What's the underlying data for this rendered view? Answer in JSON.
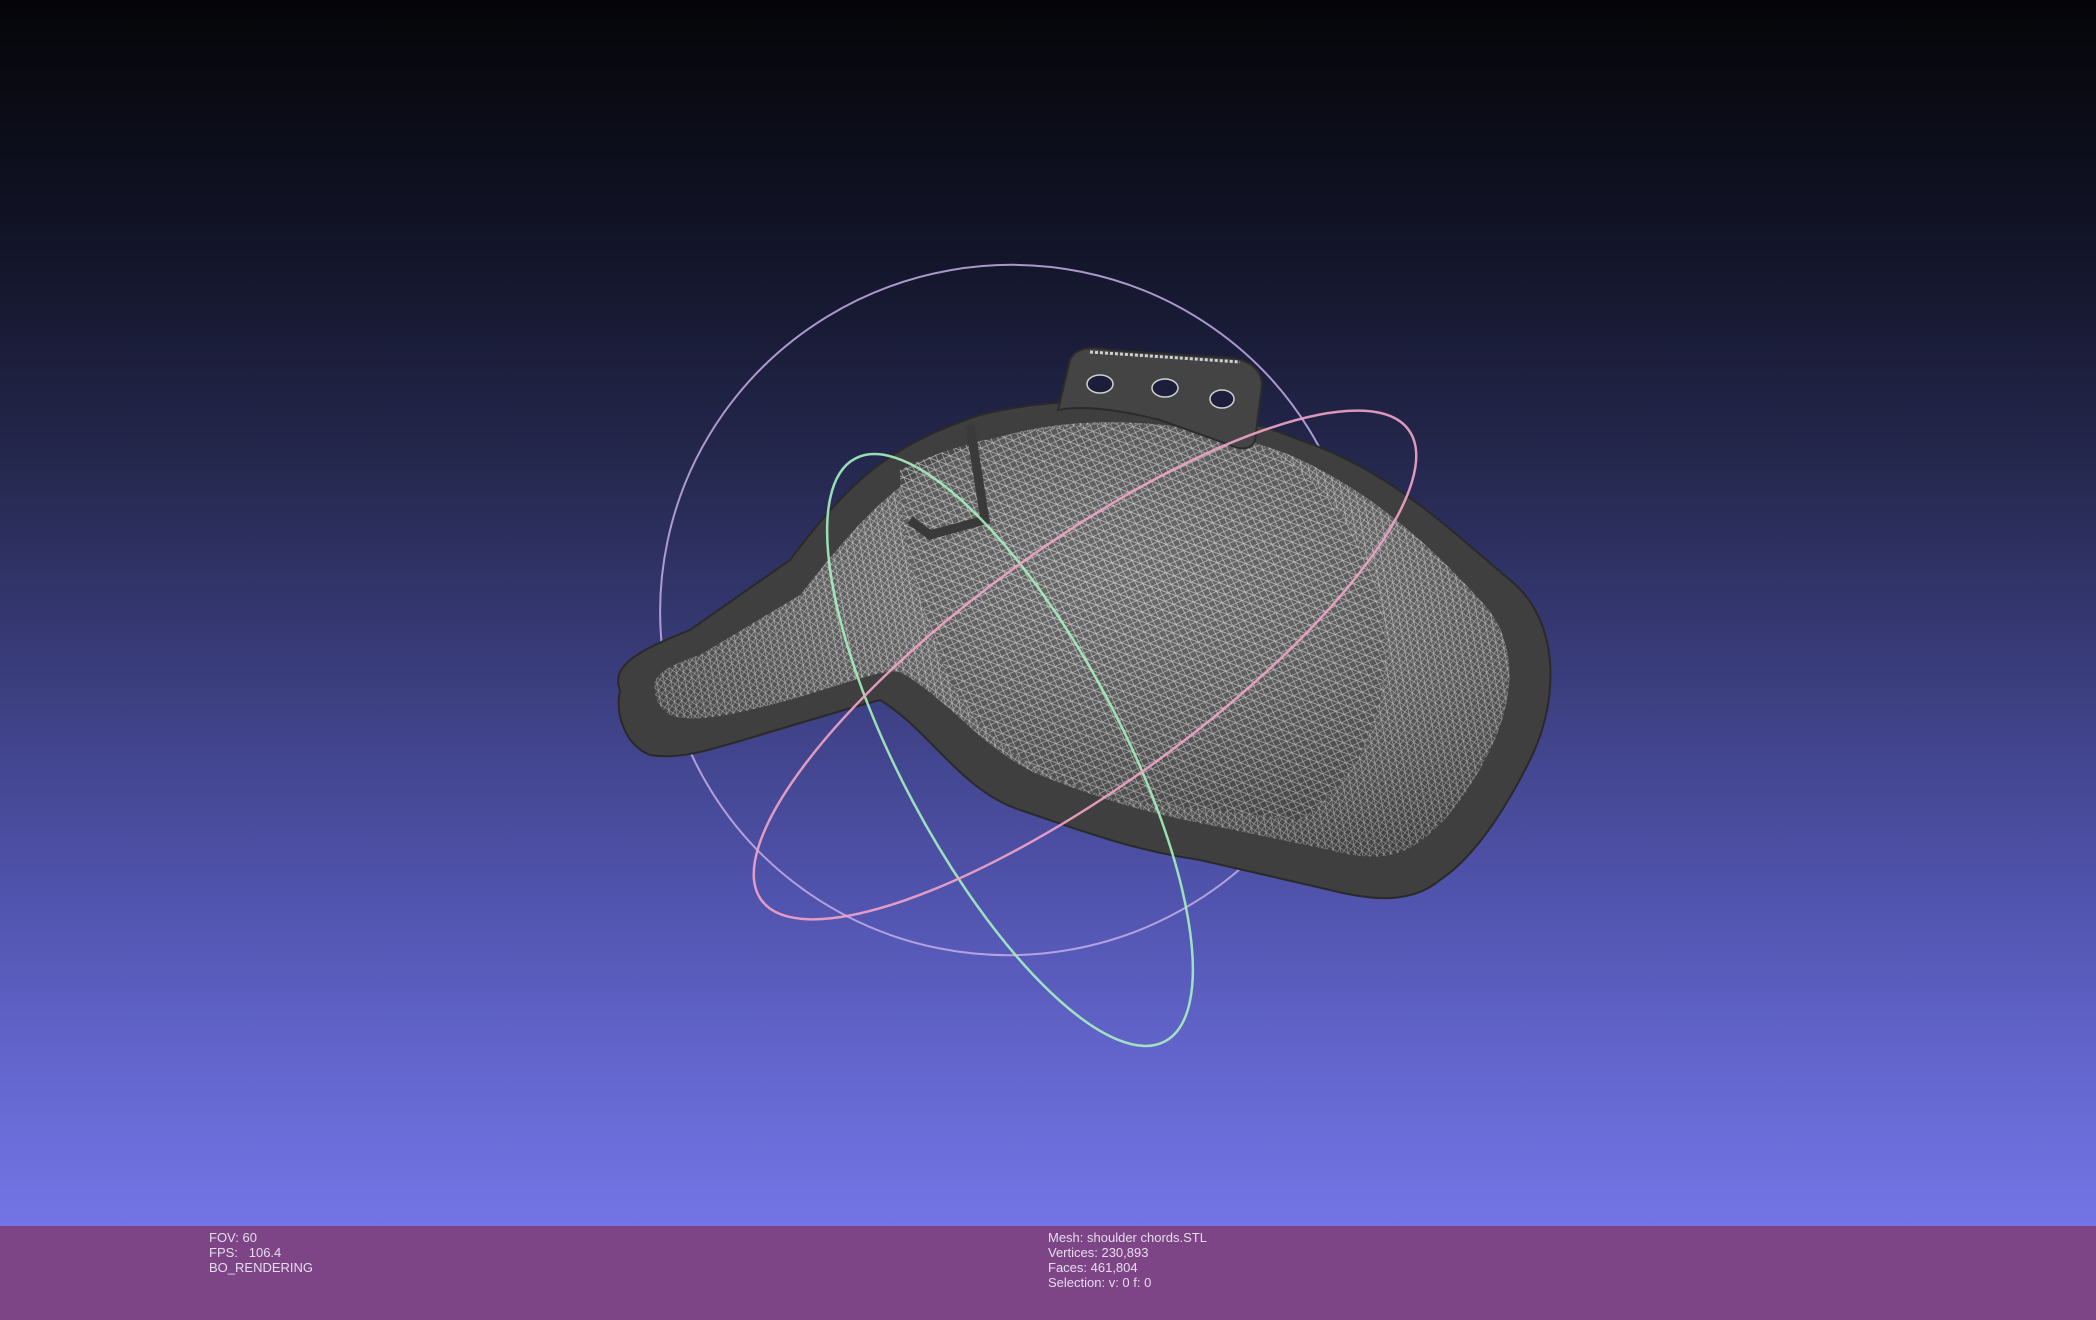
{
  "viewport": {
    "background_top": "#050508",
    "background_bottom": "#7375e6",
    "mesh_color": "#4a4a4a",
    "wireframe_color": "#d8d8d8"
  },
  "trackball": {
    "ring_colors": [
      "#a0ffa0",
      "#ff9fb0",
      "#c7b0ff"
    ]
  },
  "info_bar": {
    "background": "#7d4586",
    "fov": "FOV: 60",
    "fps": "FPS:   106.4",
    "render_mode": "BO_RENDERING",
    "mesh_name": "Mesh: shoulder chords.STL",
    "vertices": "Vertices: 230,893",
    "faces": "Faces: 461,804",
    "selection": "Selection: v: 0 f: 0"
  }
}
